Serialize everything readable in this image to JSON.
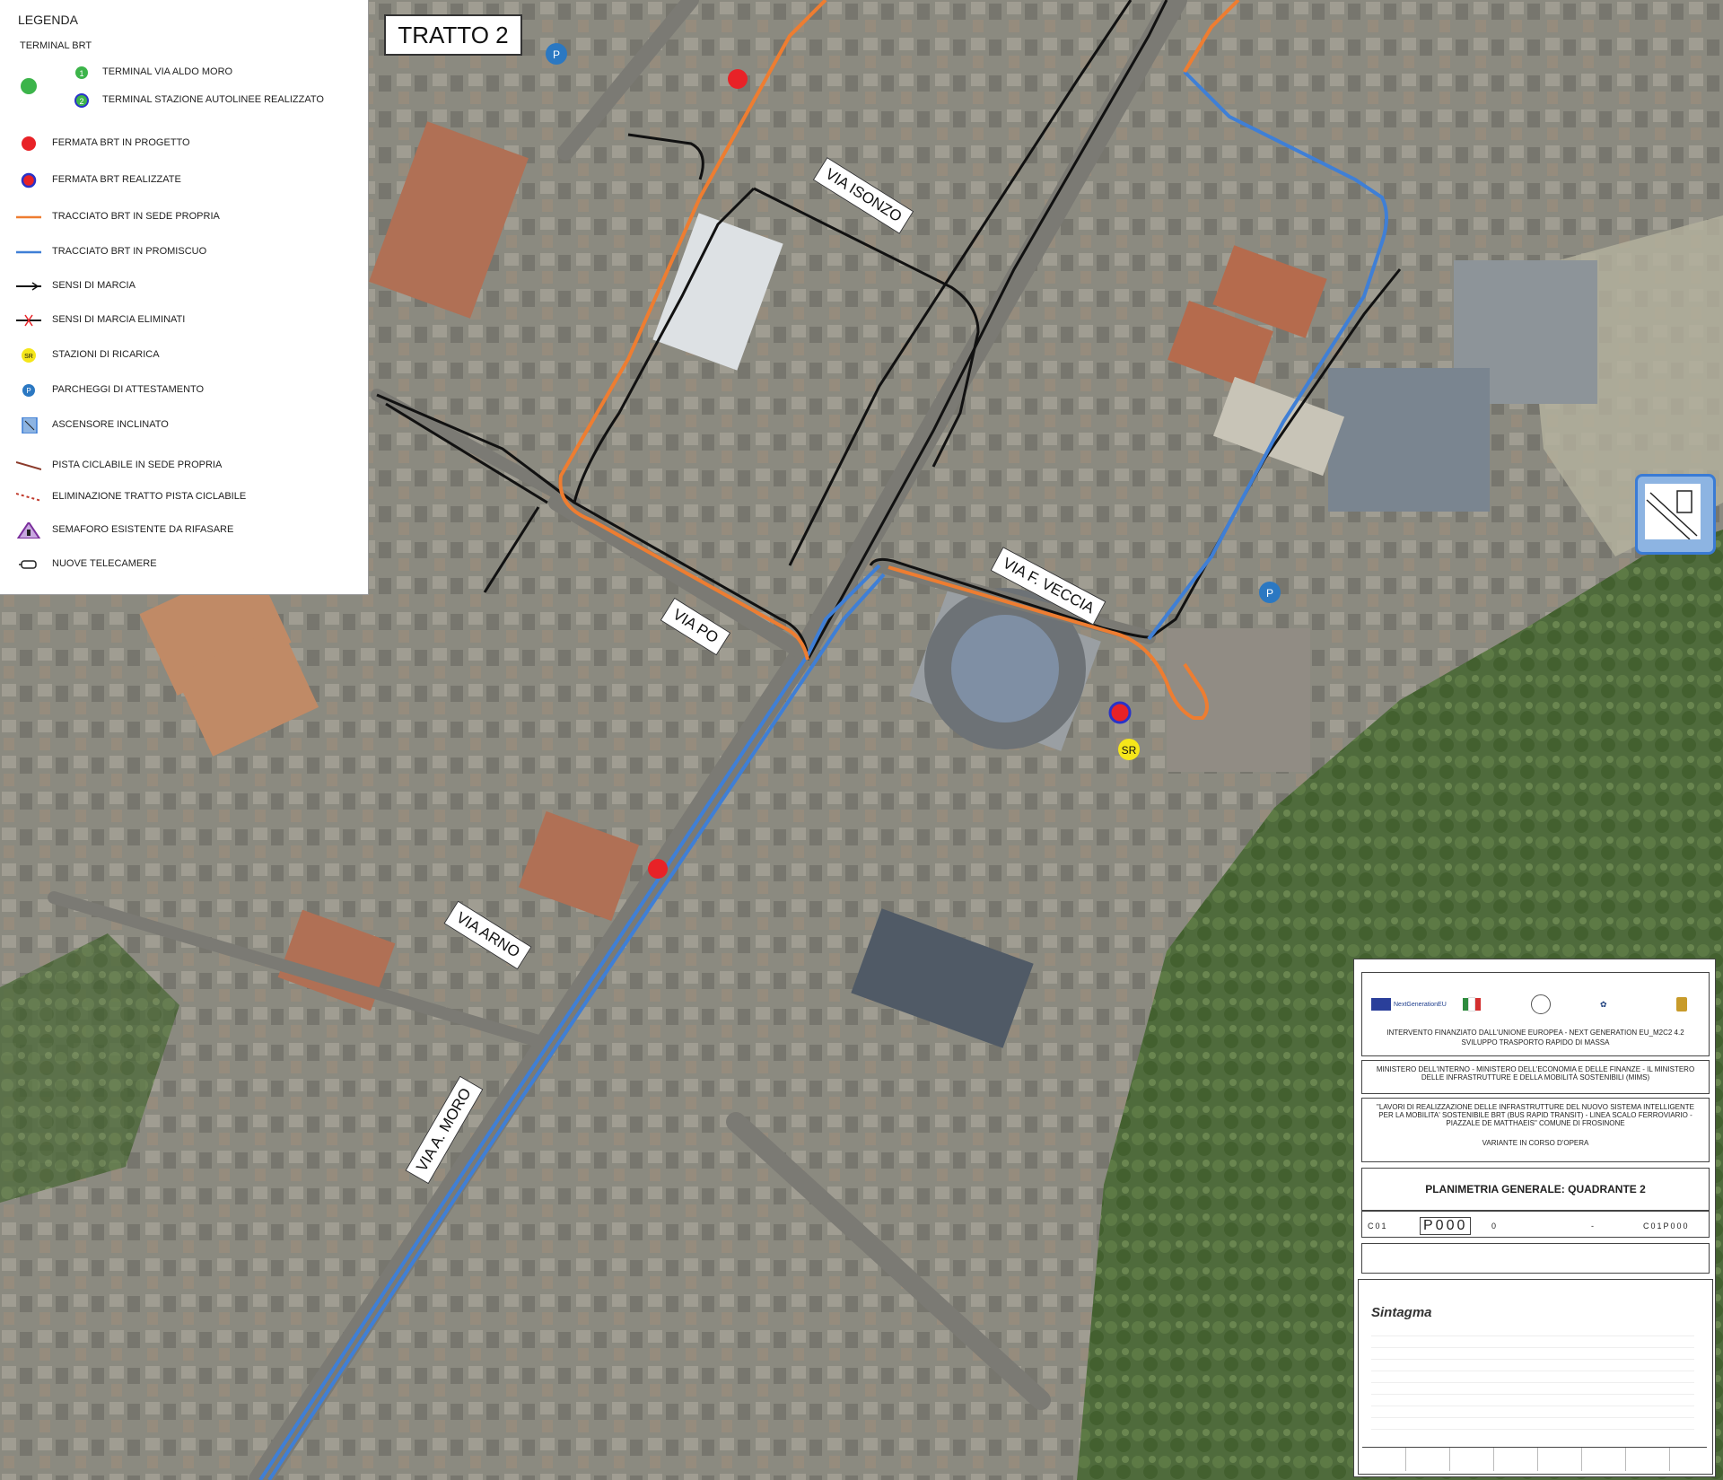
{
  "legend": {
    "title": "LEGENDA",
    "subtitle": "TERMINAL BRT",
    "items": [
      {
        "label": "TERMINAL VIA ALDO MORO"
      },
      {
        "label": "TERMINAL STAZIONE AUTOLINEE REALIZZATO"
      },
      {
        "label": "FERMATA BRT IN PROGETTO"
      },
      {
        "label": "FERMATA BRT REALIZZATE"
      },
      {
        "label": "TRACCIATO BRT IN SEDE PROPRIA"
      },
      {
        "label": "TRACCIATO BRT IN PROMISCUO"
      },
      {
        "label": "SENSI DI MARCIA"
      },
      {
        "label": "SENSI DI MARCIA ELIMINATI"
      },
      {
        "label": "STAZIONI DI RICARICA"
      },
      {
        "label": "PARCHEGGI DI ATTESTAMENTO"
      },
      {
        "label": "ASCENSORE INCLINATO"
      },
      {
        "label": "PISTA CICLABILE IN SEDE PROPRIA"
      },
      {
        "label": "ELIMINAZIONE TRATTO PISTA CICLABILE"
      },
      {
        "label": "SEMAFORO ESISTENTE DA RIFASARE"
      },
      {
        "label": "NUOVE TELECAMERE"
      }
    ],
    "terminal_numbers": [
      "1",
      "2"
    ],
    "sr_symbol": "SR",
    "p_symbol": "P"
  },
  "map": {
    "section_label": "TRATTO 2",
    "streets": [
      "VIA ISONZO",
      "VIA PO",
      "VIA F. VECCIA",
      "VIA ARNO",
      "VIA A. MORO"
    ],
    "sr_marker": "SR",
    "parking_marker": "P",
    "colors": {
      "sede_propria": "#ee7d31",
      "promiscuo": "#3f7fd6",
      "sensi": "#111111",
      "fermata": "#e82227",
      "ricarica": "#f5e61a"
    }
  },
  "title_block": {
    "funding_line1": "INTERVENTO FINANZIATO DALL'UNIONE EUROPEA - NEXT GENERATION EU_M2C2 4.2",
    "funding_line2": "SVILUPPO TRASPORTO RAPIDO DI MASSA",
    "ministries": "MINISTERO DELL'INTERNO - MINISTERO DELL'ECONOMIA E DELLE FINANZE - IL MINISTERO DELLE INFRASTRUTTURE E DELLA MOBILITÀ SOSTENIBILI (MIMS)",
    "project": "\"LAVORI DI REALIZZAZIONE DELLE INFRASTRUTTURE DEL NUOVO SISTEMA INTELLIGENTE PER LA MOBILITA' SOSTENIBILE BRT (BUS RAPID TRANSIT) - LINEA SCALO FERROVIARIO - PIAZZALE DE MATTHAEIS\" COMUNE DI FROSINONE",
    "variant": "VARIANTE IN CORSO D'OPERA",
    "drawing_title": "PLANIMETRIA GENERALE: QUADRANTE 2",
    "code_main": "P000",
    "code_left": "C01",
    "rev": "0",
    "scala": "-",
    "file": "C01P000",
    "company": "Sintagma"
  }
}
